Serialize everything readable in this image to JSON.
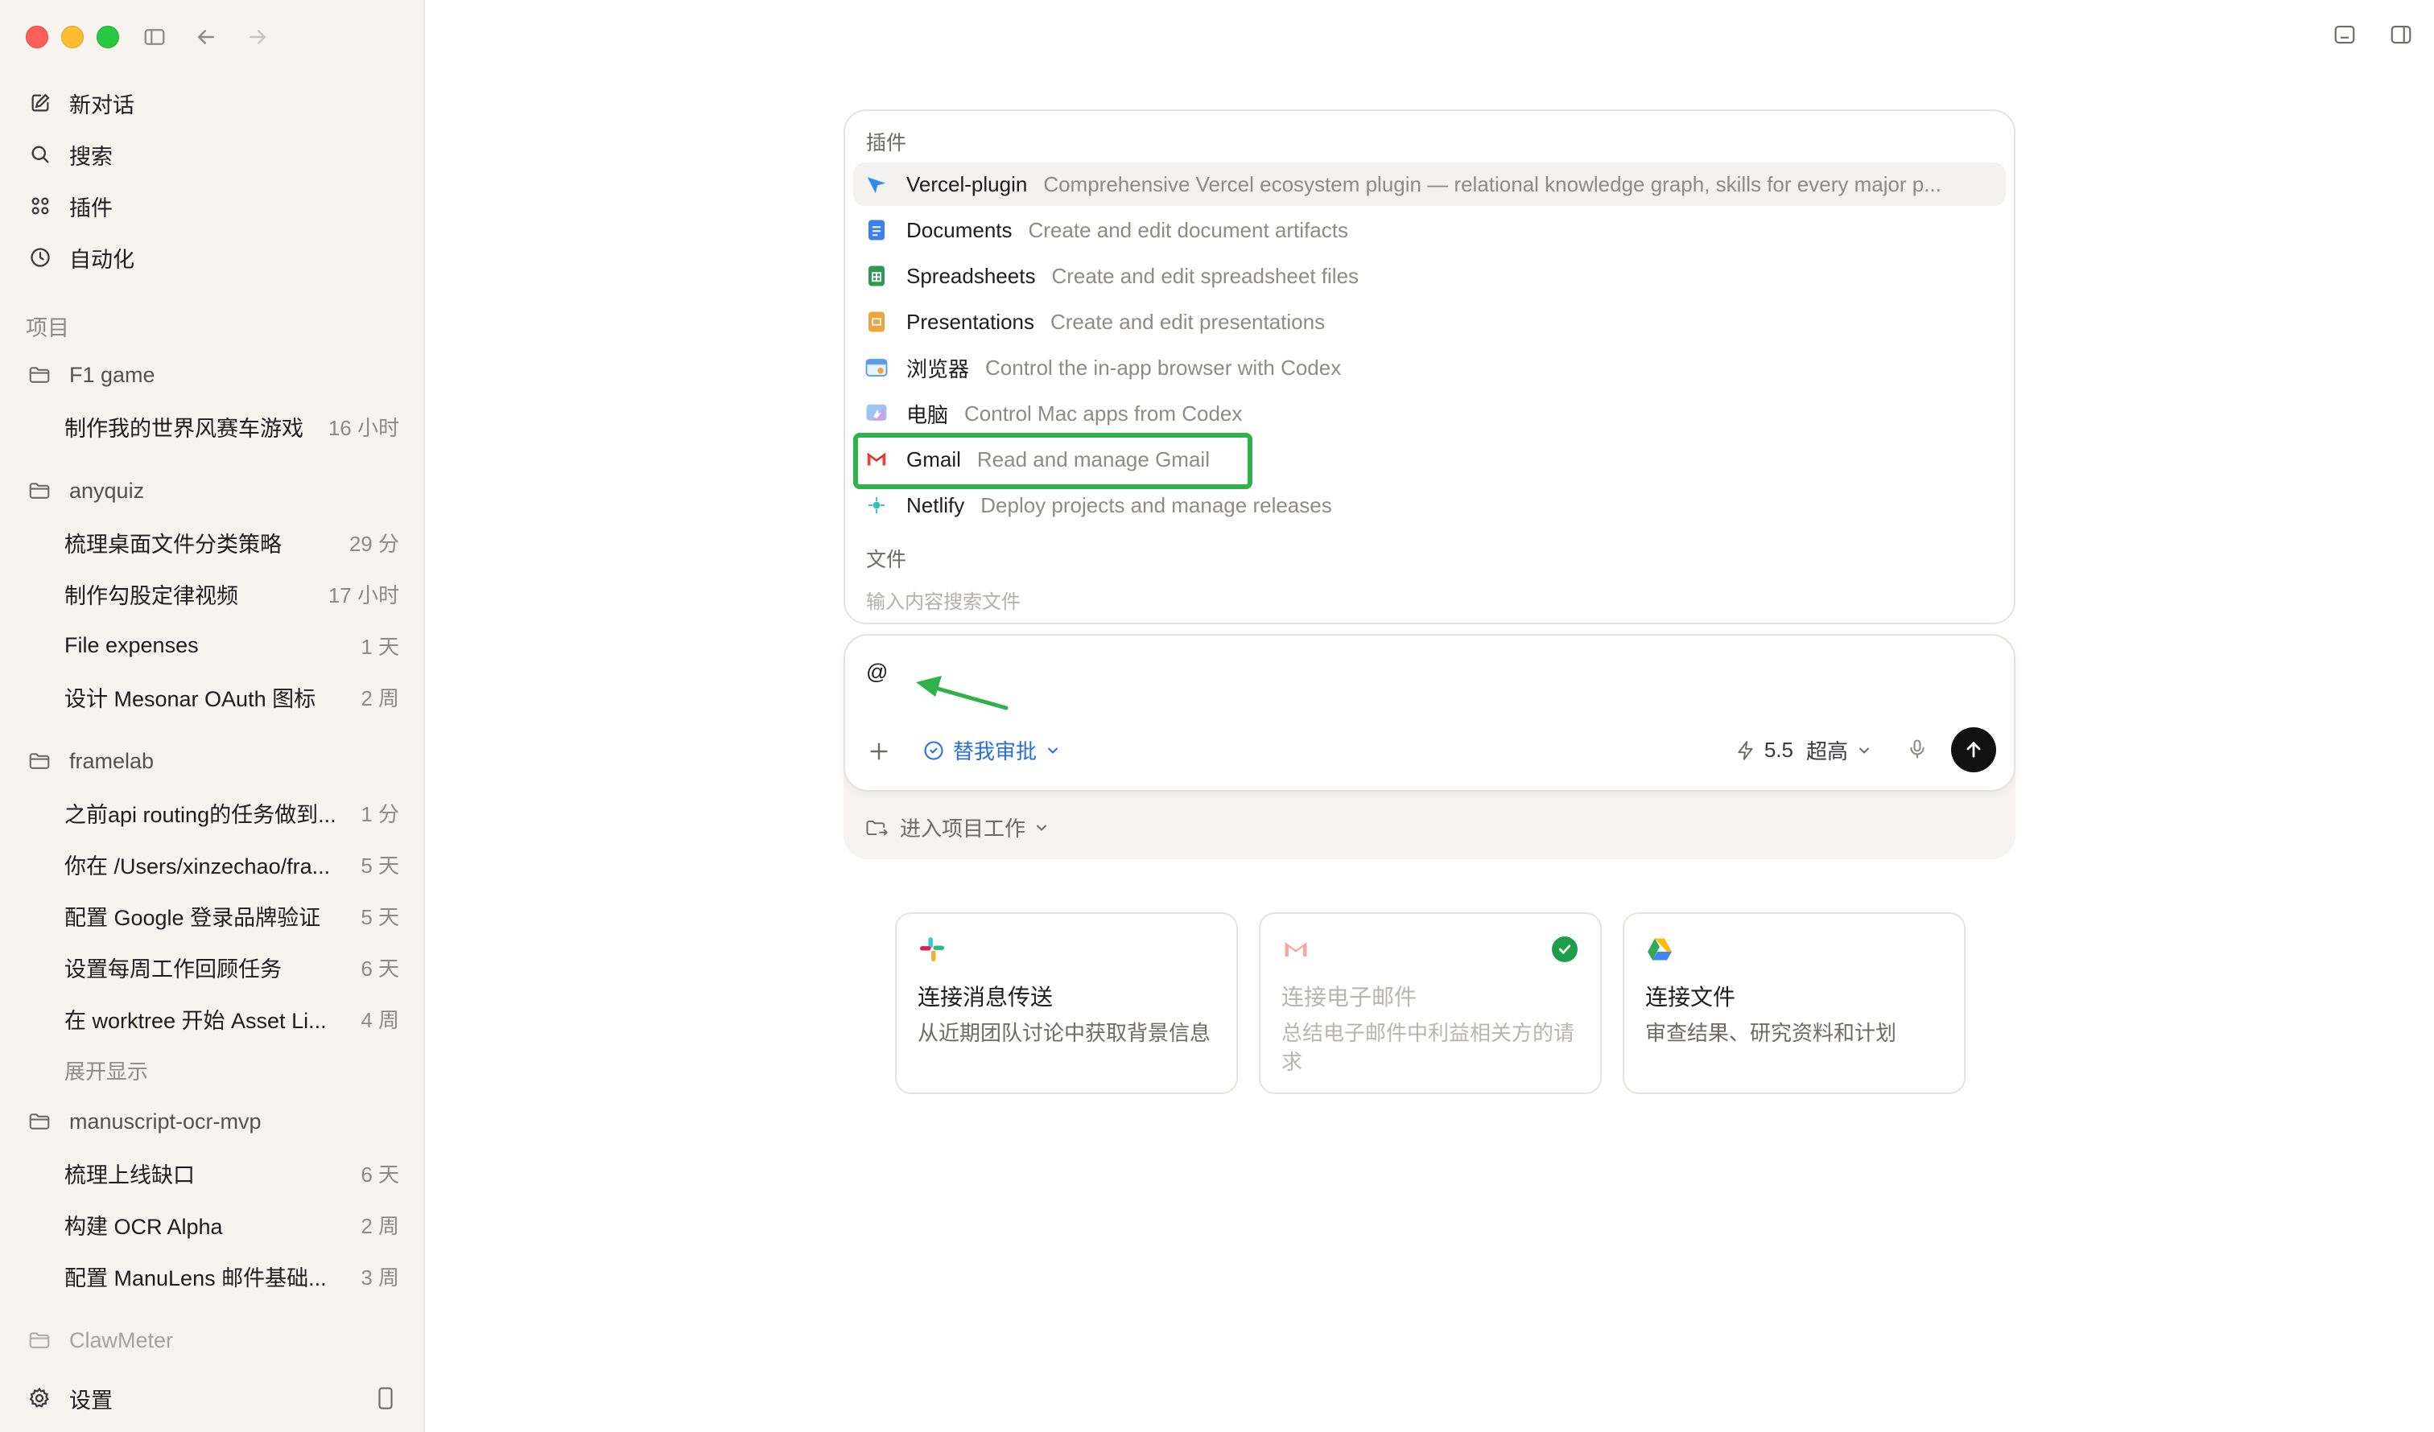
{
  "sidebar": {
    "nav": [
      {
        "label": "新对话",
        "icon": "compose-icon"
      },
      {
        "label": "搜索",
        "icon": "search-icon"
      },
      {
        "label": "插件",
        "icon": "grid-icon"
      },
      {
        "label": "自动化",
        "icon": "clock-icon"
      }
    ],
    "projects_label": "项目",
    "projects": [
      {
        "name": "F1 game",
        "threads": [
          {
            "title": "制作我的世界风赛车游戏",
            "time": "16 小时"
          }
        ]
      },
      {
        "name": "anyquiz",
        "threads": [
          {
            "title": "梳理桌面文件分类策略",
            "time": "29 分"
          },
          {
            "title": "制作勾股定律视频",
            "time": "17 小时"
          },
          {
            "title": "File expenses",
            "time": "1 天"
          },
          {
            "title": "设计 Mesonar OAuth 图标",
            "time": "2 周"
          }
        ]
      },
      {
        "name": "framelab",
        "threads": [
          {
            "title": "之前api routing的任务做到...",
            "time": "1 分"
          },
          {
            "title": "你在 /Users/xinzechao/fra...",
            "time": "5 天"
          },
          {
            "title": "配置 Google 登录品牌验证",
            "time": "5 天"
          },
          {
            "title": "设置每周工作回顾任务",
            "time": "6 天"
          },
          {
            "title": "在 worktree 开始 Asset Li...",
            "time": "4 周"
          }
        ],
        "expand": "展开显示"
      },
      {
        "name": "manuscript-ocr-mvp",
        "threads": [
          {
            "title": "梳理上线缺口",
            "time": "6 天"
          },
          {
            "title": "构建 OCR Alpha",
            "time": "2 周"
          },
          {
            "title": "配置 ManuLens 邮件基础...",
            "time": "3 周"
          }
        ]
      },
      {
        "name": "ClawMeter",
        "threads": []
      }
    ],
    "settings_label": "设置"
  },
  "popup": {
    "plugins_label": "插件",
    "plugins": [
      {
        "name": "Vercel-plugin",
        "desc": "Comprehensive Vercel ecosystem plugin — relational knowledge graph, skills for every major p...",
        "icon": "vercel-icon"
      },
      {
        "name": "Documents",
        "desc": "Create and edit document artifacts",
        "icon": "document-icon"
      },
      {
        "name": "Spreadsheets",
        "desc": "Create and edit spreadsheet files",
        "icon": "spreadsheet-icon"
      },
      {
        "name": "Presentations",
        "desc": "Create and edit presentations",
        "icon": "presentation-icon"
      },
      {
        "name": "浏览器",
        "desc": "Control the in-app browser with Codex",
        "icon": "browser-icon"
      },
      {
        "name": "电脑",
        "desc": "Control Mac apps from Codex",
        "icon": "computer-icon"
      },
      {
        "name": "Gmail",
        "desc": "Read and manage Gmail",
        "icon": "gmail-icon"
      },
      {
        "name": "Netlify",
        "desc": "Deploy projects and manage releases",
        "icon": "netlify-icon"
      }
    ],
    "files_label": "文件",
    "files_hint": "输入内容搜索文件"
  },
  "composer": {
    "value": "@",
    "approve_label": "替我审批",
    "model_version": "5.5",
    "model_effort": "超高",
    "project_enter": "进入项目工作"
  },
  "cards": [
    {
      "title": "连接消息传送",
      "desc": "从近期团队讨论中获取背景信息",
      "icon": "slack-icon",
      "connected": false
    },
    {
      "title": "连接电子邮件",
      "desc": "总结电子邮件中利益相关方的请求",
      "icon": "gmail-icon",
      "connected": true
    },
    {
      "title": "连接文件",
      "desc": "审查结果、研究资料和计划",
      "icon": "google-drive-icon",
      "connected": false
    }
  ],
  "colors": {
    "accent": "#2a6ee6",
    "highlight": "#2fb24a",
    "annotation_arrow": "#2fb24a"
  }
}
